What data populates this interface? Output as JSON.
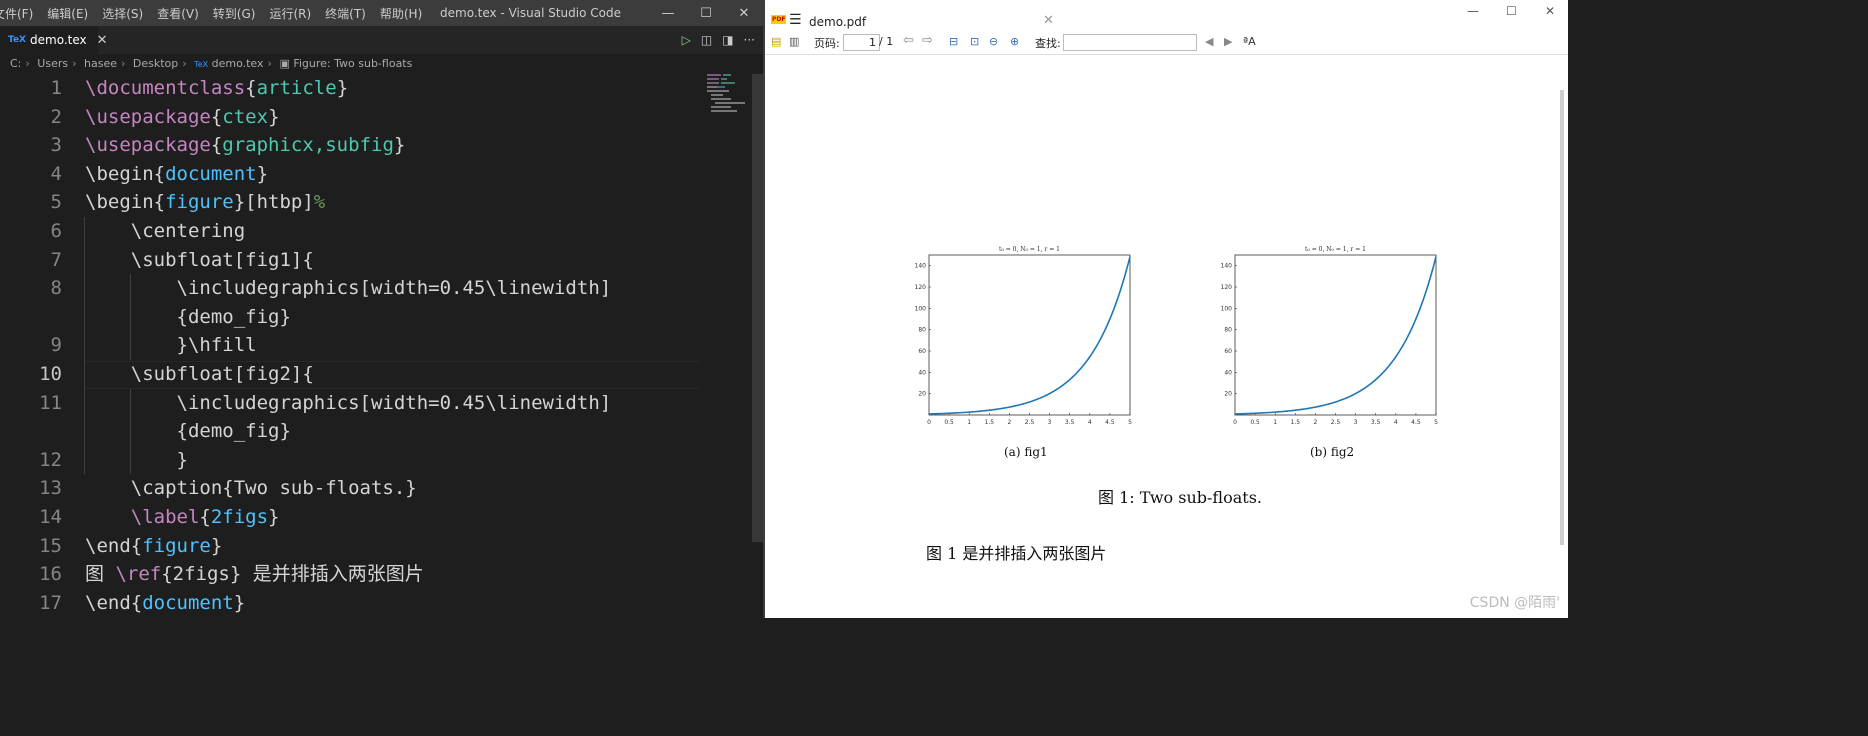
{
  "vscode": {
    "menu": [
      "文件(F)",
      "编辑(E)",
      "选择(S)",
      "查看(V)",
      "转到(G)",
      "运行(R)",
      "终端(T)",
      "帮助(H)"
    ],
    "window_title": "demo.tex - Visual Studio Code",
    "tab": {
      "icon_text": "TeX",
      "label": "demo.tex",
      "close": "✕"
    },
    "breadcrumbs": [
      "C:",
      "Users",
      "hasee",
      "Desktop",
      "demo.tex",
      "Figure:  Two sub-floats"
    ],
    "line_numbers": [
      "1",
      "2",
      "3",
      "4",
      "5",
      "6",
      "7",
      "8",
      "",
      "9",
      "10",
      "11",
      "",
      "12",
      "13",
      "14",
      "15",
      "16",
      "17"
    ],
    "active_line": "10"
  },
  "pdf": {
    "tab_label": "demo.pdf",
    "toolbar": {
      "page_label": "页码:",
      "page_value": "1",
      "page_total": "/ 1",
      "find_label": "查找:"
    },
    "subfig_title": "t₀ = 0, N₀ = 1, r = 1",
    "captions": {
      "a": "(a) fig1",
      "b": "(b) fig2",
      "figure": "图 1:  Two sub-floats.",
      "body": "图 1 是并排插入两张图片"
    },
    "watermark": "CSDN @陌雨'"
  },
  "chart_data": [
    {
      "type": "line",
      "title": "t₀ = 0, N₀ = 1, r = 1",
      "x": [
        0,
        0.5,
        1,
        1.5,
        2,
        2.5,
        3,
        3.5,
        4,
        4.5,
        5
      ],
      "series": [
        {
          "values": [
            1,
            1.65,
            2.72,
            4.48,
            7.39,
            12.18,
            20.09,
            33.12,
            54.6,
            90.02,
            148.41
          ]
        }
      ],
      "xticks": [
        "0",
        "0.5",
        "1",
        "1.5",
        "2",
        "2.5",
        "3",
        "3.5",
        "4",
        "4.5",
        "5"
      ],
      "yticks": [
        "20",
        "40",
        "60",
        "80",
        "100",
        "120",
        "140"
      ],
      "xlim": [
        0,
        5
      ],
      "ylim": [
        0,
        150
      ],
      "color": "#1f77b4"
    },
    {
      "type": "line",
      "title": "t₀ = 0, N₀ = 1, r = 1",
      "x": [
        0,
        0.5,
        1,
        1.5,
        2,
        2.5,
        3,
        3.5,
        4,
        4.5,
        5
      ],
      "series": [
        {
          "values": [
            1,
            1.65,
            2.72,
            4.48,
            7.39,
            12.18,
            20.09,
            33.12,
            54.6,
            90.02,
            148.41
          ]
        }
      ],
      "xticks": [
        "0",
        "0.5",
        "1",
        "1.5",
        "2",
        "2.5",
        "3",
        "3.5",
        "4",
        "4.5",
        "5"
      ],
      "yticks": [
        "20",
        "40",
        "60",
        "80",
        "100",
        "120",
        "140"
      ],
      "xlim": [
        0,
        5
      ],
      "ylim": [
        0,
        150
      ],
      "color": "#1f77b4"
    }
  ],
  "code_lines": [
    [
      "mac:\\documentclass",
      "kw:{",
      "arg:article",
      "kw:}"
    ],
    [
      "mac:\\usepackage",
      "kw:{",
      "arg:ctex",
      "kw:}"
    ],
    [
      "mac:\\usepackage",
      "kw:{",
      "arg:graphicx,subfig",
      "kw:}"
    ],
    [
      "kw:\\begin{",
      "env:document",
      "kw:}"
    ],
    [
      "kw:\\begin{",
      "env:figure",
      "kw:}[htbp]",
      "cmt:%"
    ],
    [
      "kw:    \\centering"
    ],
    [
      "kw:    \\subfloat[fig1]{"
    ],
    [
      "kw:        \\includegraphics[width=0.45\\linewidth]"
    ],
    [
      "kw:        {demo_fig}"
    ],
    [
      "kw:        }\\hfill"
    ],
    [
      "kw:    \\subfloat[fig2]{"
    ],
    [
      "kw:        \\includegraphics[width=0.45\\linewidth]"
    ],
    [
      "kw:        {demo_fig}"
    ],
    [
      "kw:        }"
    ],
    [
      "kw:    \\caption{Two sub-floats.}"
    ],
    [
      "mac:    \\label",
      "kw:{",
      "env:2figs",
      "kw:}"
    ],
    [
      "kw:\\end{",
      "env:figure",
      "kw:}"
    ],
    [
      "kw:图 ",
      "mac:\\ref",
      "kw:{2figs} 是并排插入两张图片"
    ],
    [
      "kw:\\end{",
      "env:document",
      "kw:}"
    ]
  ]
}
